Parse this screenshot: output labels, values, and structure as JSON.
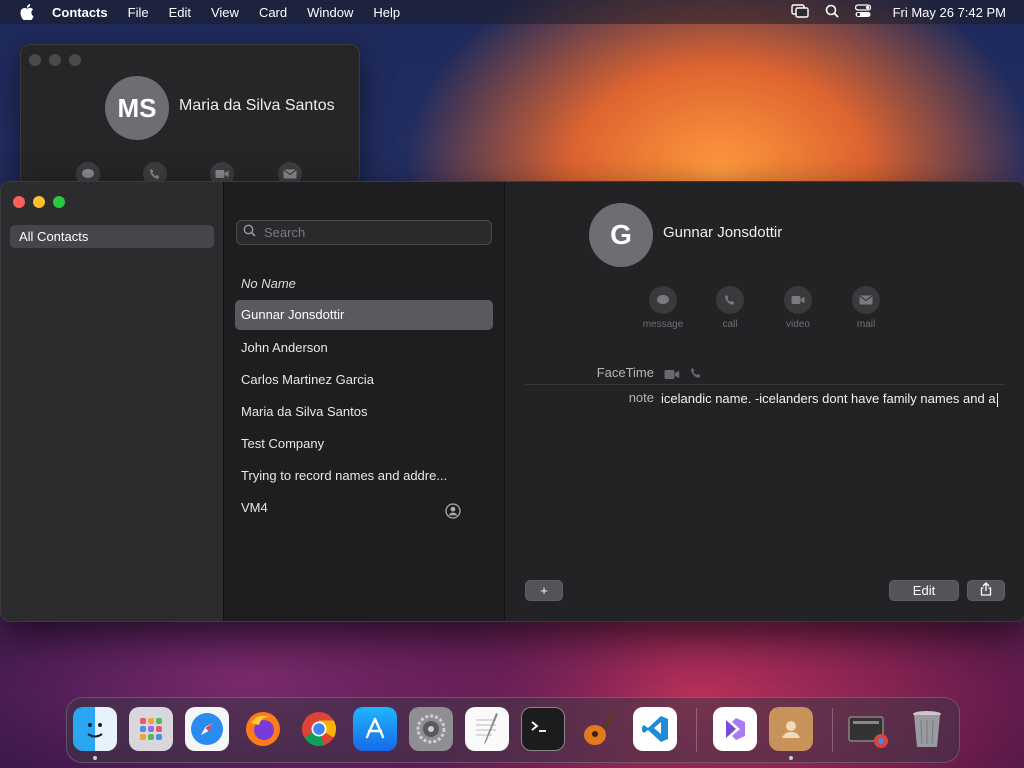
{
  "menubar": {
    "app": "Contacts",
    "items": [
      "File",
      "Edit",
      "View",
      "Card",
      "Window",
      "Help"
    ],
    "clock": "Fri May 26  7:42 PM"
  },
  "back_window": {
    "initials": "MS",
    "name": "Maria da Silva Santos"
  },
  "sidebar": {
    "group": "All Contacts"
  },
  "list": {
    "search_placeholder": "Search",
    "contacts": [
      "No Name",
      "Gunnar Jonsdottir",
      "John Anderson",
      "Carlos Martinez Garcia",
      "Maria da Silva Santos",
      "Test Company",
      "Trying to record names and addre...",
      "VM4"
    ],
    "selected_index": 1
  },
  "detail": {
    "initial": "G",
    "name": "Gunnar Jonsdottir",
    "actions": [
      "message",
      "call",
      "video",
      "mail"
    ],
    "facetime_label": "FaceTime",
    "note_label": "note",
    "note_text": "icelandic name. -icelanders dont have family names and a",
    "edit_label": "Edit",
    "add_label": "+"
  },
  "dock": {
    "apps": [
      "finder-icon",
      "launchpad-icon",
      "safari-icon",
      "firefox-icon",
      "chrome-icon",
      "app-store-icon",
      "system-settings-icon",
      "textedit-icon",
      "terminal-icon",
      "garageband-icon",
      "vscode-icon",
      "visual-studio-icon",
      "contacts-icon",
      "preview-icon",
      "trash-icon"
    ]
  },
  "colors": {
    "close": "#ff5f57",
    "minimize": "#febc2e",
    "zoom": "#28c840",
    "selection": "#5a5a5e"
  }
}
